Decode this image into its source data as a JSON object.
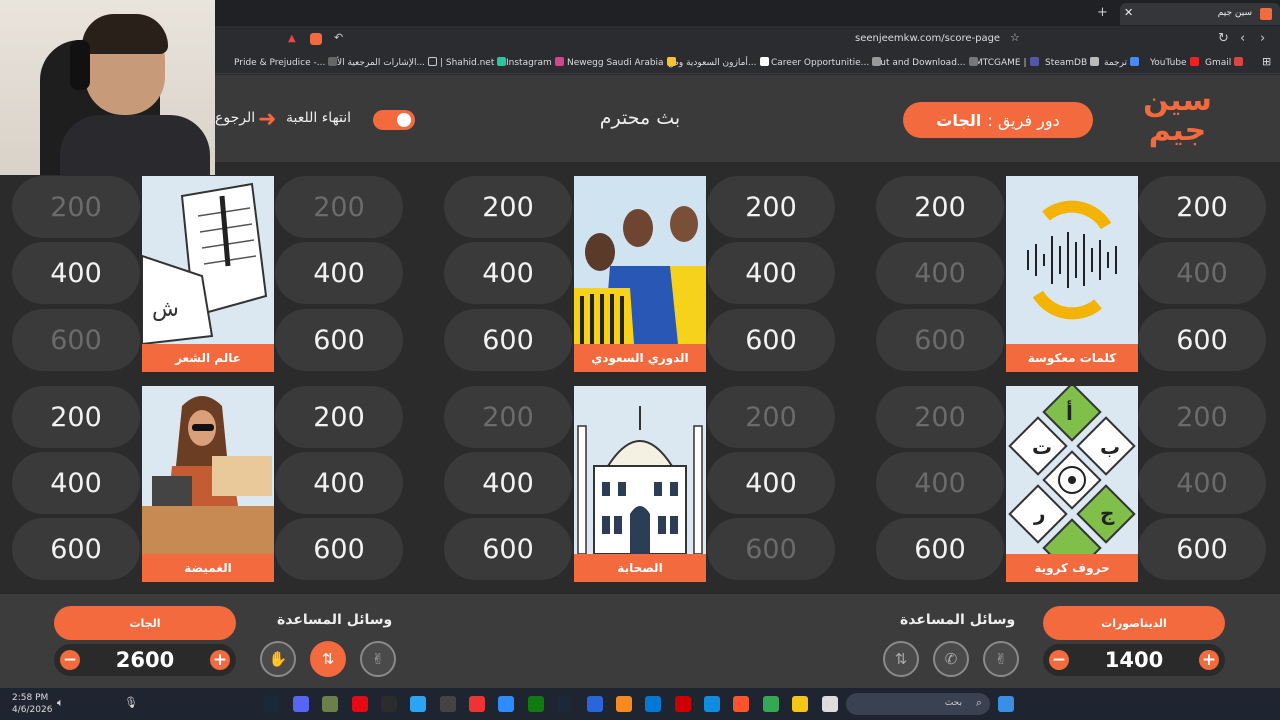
{
  "browser": {
    "tab_title": "سين جيم",
    "url": "seenjeemkw.com/score-page",
    "bookmarks": [
      "Gmail",
      "YouTube",
      "ترجمة",
      "SteamDB",
      "MTCGAME |",
      "Cut and Download...",
      "Career Opportunitie...",
      "أمازون السعودية وص...",
      "Newegg Saudi Arabia",
      "Instagram",
      "| Shahid.net",
      "الإشارات المرجعية الأ...",
      "Pride & Prejudice -..."
    ]
  },
  "header": {
    "brand": "سين جيم",
    "turn_label": "دور فريق :",
    "turn_team": "الجات",
    "title": "بث محترم",
    "end_game": "انتهاء اللعبة",
    "back": "الرجوع"
  },
  "board": {
    "categories": [
      {
        "name": "كلمات معكوسة",
        "icon": "reverse-sound-icon"
      },
      {
        "name": "الدوري السعودي",
        "icon": "football-players-icon"
      },
      {
        "name": "عالم الشعر",
        "icon": "poetry-paper-icon"
      },
      {
        "name": "حروف كروية",
        "icon": "letters-ball-icon"
      },
      {
        "name": "الصحابة",
        "icon": "mosque-icon"
      },
      {
        "name": "الغميضة",
        "icon": "woman-sewing-icon"
      }
    ],
    "points": {
      "cat0_left": [
        "200",
        "400",
        "600"
      ],
      "cat0_right": [
        "200",
        "400",
        "600"
      ],
      "cat1_left": [
        "200",
        "400",
        "600"
      ],
      "cat1_right": [
        "200",
        "400",
        "600"
      ],
      "cat2_left": [
        "200",
        "400",
        "600"
      ],
      "cat2_right": [
        "200",
        "400",
        "600"
      ],
      "cat3_left": [
        "200",
        "400",
        "600"
      ],
      "cat3_right": [
        "200",
        "400",
        "600"
      ],
      "cat4_left": [
        "200",
        "400",
        "600"
      ],
      "cat4_right": [
        "200",
        "400",
        "600"
      ],
      "cat5_left": [
        "200",
        "400",
        "600"
      ],
      "cat5_right": [
        "200",
        "400",
        "600"
      ]
    }
  },
  "teams": {
    "left": {
      "name": "الجات",
      "score": "2600",
      "aids_title": "وسائل المساعدة"
    },
    "right": {
      "name": "الديناصورات",
      "score": "1400",
      "aids_title": "وسائل المساعدة"
    }
  },
  "taskbar": {
    "time": "2:58 PM",
    "date": "4/6/2026",
    "search": "بحث"
  },
  "colors": {
    "accent": "#f26a3d",
    "bg": "#2b2b2b",
    "pill": "#3a3a3a"
  }
}
